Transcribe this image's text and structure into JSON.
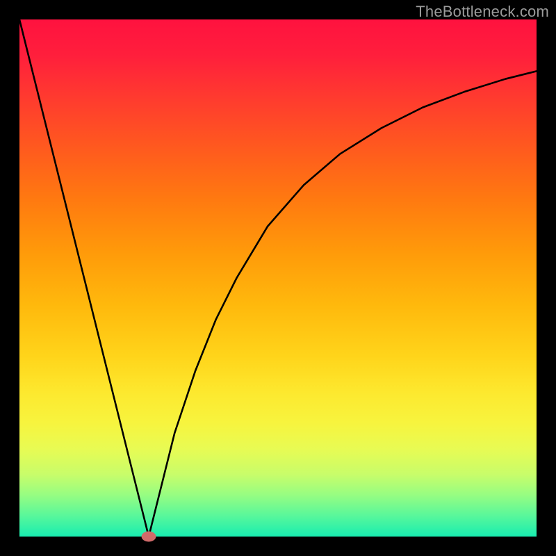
{
  "watermark": "TheBottleneck.com",
  "chart_data": {
    "type": "line",
    "title": "",
    "xlabel": "",
    "ylabel": "",
    "xlim": [
      0,
      100
    ],
    "ylim": [
      0,
      100
    ],
    "grid": false,
    "series": [
      {
        "name": "curve",
        "points": [
          {
            "x": 0,
            "y": 100
          },
          {
            "x": 5,
            "y": 80
          },
          {
            "x": 10,
            "y": 60
          },
          {
            "x": 15,
            "y": 40
          },
          {
            "x": 20,
            "y": 20
          },
          {
            "x": 24,
            "y": 4
          },
          {
            "x": 25,
            "y": 0
          },
          {
            "x": 26,
            "y": 4
          },
          {
            "x": 28,
            "y": 12
          },
          {
            "x": 30,
            "y": 20
          },
          {
            "x": 34,
            "y": 32
          },
          {
            "x": 38,
            "y": 42
          },
          {
            "x": 42,
            "y": 50
          },
          {
            "x": 48,
            "y": 60
          },
          {
            "x": 55,
            "y": 68
          },
          {
            "x": 62,
            "y": 74
          },
          {
            "x": 70,
            "y": 79
          },
          {
            "x": 78,
            "y": 83
          },
          {
            "x": 86,
            "y": 86
          },
          {
            "x": 94,
            "y": 88.5
          },
          {
            "x": 100,
            "y": 90
          }
        ]
      }
    ],
    "marker": {
      "x": 25,
      "y": 0,
      "rx": 1.4,
      "ry": 1.0
    },
    "colors": {
      "curve": "#000000",
      "marker": "#d06a6a",
      "background_top": "#ff123f",
      "background_bottom": "#18edb0",
      "frame": "#000000"
    }
  }
}
